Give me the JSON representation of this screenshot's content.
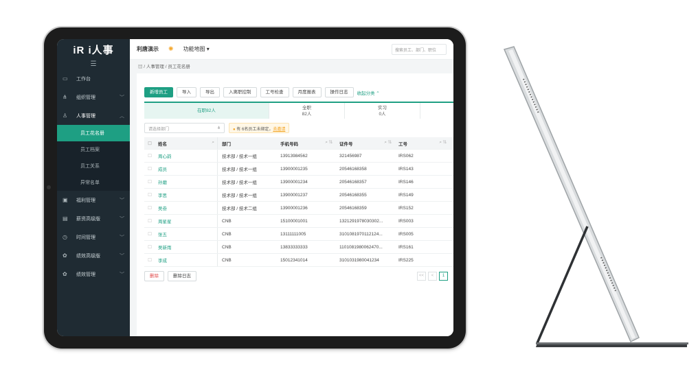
{
  "app": {
    "logo": "iR i人事",
    "company": "利唐演示",
    "feature_map": "功能地图 ▾",
    "search_placeholder": "搜索员工、部门、职位"
  },
  "sidebar": {
    "hamburger": "☰",
    "items": [
      {
        "label": "工作台",
        "icon": "monitor-icon",
        "glyph": "▭",
        "chevron": ""
      },
      {
        "label": "组织管理",
        "icon": "org-icon",
        "glyph": "⋔",
        "chevron": "﹀"
      },
      {
        "label": "人事管理",
        "icon": "person-icon",
        "glyph": "♙",
        "chevron": "︿"
      },
      {
        "label": "福利管理",
        "icon": "gift-icon",
        "glyph": "▣",
        "chevron": "﹀"
      },
      {
        "label": "薪资高级版",
        "icon": "wallet-icon",
        "glyph": "▤",
        "chevron": "﹀"
      },
      {
        "label": "时间管理",
        "icon": "clock-icon",
        "glyph": "◷",
        "chevron": "﹀"
      },
      {
        "label": "绩效高级版",
        "icon": "chart-icon",
        "glyph": "✿",
        "chevron": "﹀"
      },
      {
        "label": "绩效管理",
        "icon": "performance-icon",
        "glyph": "✿",
        "chevron": "﹀"
      }
    ],
    "sub_items": [
      "员工花名册",
      "员工档案",
      "员工关系",
      "异常名单"
    ]
  },
  "breadcrumb": "▤ / 人事管理 / 员工花名册",
  "toolbar": {
    "add": "新增员工",
    "import": "导入",
    "export": "导出",
    "onboard": "入离职控制",
    "id_check": "工号检查",
    "monthly": "月度报表",
    "log": "操作日志",
    "collapse": "收起分类 ⌃"
  },
  "stats": [
    {
      "label": "在职82人",
      "value": ""
    },
    {
      "label": "全职",
      "value": "82人"
    },
    {
      "label": "实习",
      "value": "0人"
    }
  ],
  "filter": {
    "dept_placeholder": "请选择部门",
    "notice_prefix": "有",
    "notice_text": "6名员工未绑定，",
    "notice_action": "去邀请"
  },
  "table": {
    "headers": {
      "name": "姓名",
      "dept": "部门",
      "phone": "手机号码",
      "id": "证件号",
      "no": "工号"
    },
    "rows": [
      {
        "name": "周心韵",
        "dept": "技术部 / 技术一组",
        "phone": "13913984562",
        "id": "321456987",
        "no": "IRS062"
      },
      {
        "name": "成员",
        "dept": "技术部 / 技术一组",
        "phone": "13900001235",
        "id": "20546168358",
        "no": "IRS143"
      },
      {
        "name": "孙磨",
        "dept": "技术部 / 技术一组",
        "phone": "13900001234",
        "id": "20546168357",
        "no": "IRS146"
      },
      {
        "name": "李思",
        "dept": "技术部 / 技术一组",
        "phone": "13900001237",
        "id": "20546168355",
        "no": "IRS149"
      },
      {
        "name": "吴叁",
        "dept": "技术部 / 技术二组",
        "phone": "13900001236",
        "id": "20546168359",
        "no": "IRS152"
      },
      {
        "name": "周星星",
        "dept": "CNB",
        "phone": "15100001001",
        "id": "1321291978030302...",
        "no": "IRS003"
      },
      {
        "name": "张五",
        "dept": "CNB",
        "phone": "13111111005",
        "id": "3101081970112124...",
        "no": "IRS005"
      },
      {
        "name": "吴新雨",
        "dept": "CNB",
        "phone": "13833333333",
        "id": "1101081980062470...",
        "no": "IRS161"
      },
      {
        "name": "李成",
        "dept": "CNB",
        "phone": "15012341014",
        "id": "3101031980041234",
        "no": "IRS225"
      }
    ]
  },
  "footer": {
    "delete": "删除",
    "delete_log": "删除日志",
    "pager": [
      "<<",
      "<",
      "1"
    ]
  }
}
